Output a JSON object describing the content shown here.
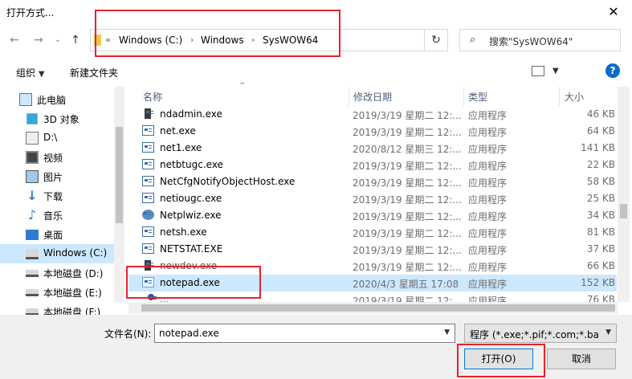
{
  "window": {
    "title": "打开方式...",
    "close_glyph": "✕"
  },
  "nav": {
    "back": "←",
    "forward": "→",
    "recent": "⌄",
    "up": "↑"
  },
  "address": {
    "prefix": "«",
    "crumbs": [
      "Windows (C:)",
      "Windows",
      "SysWOW64"
    ],
    "sep": "›",
    "refresh": "↻"
  },
  "search": {
    "placeholder": "搜索\"SysWOW64\"",
    "icon": "⌕"
  },
  "toolbar": {
    "organize": "组织",
    "new_folder": "新建文件夹",
    "help": "?"
  },
  "sidebar": {
    "items": [
      {
        "label": "此电脑",
        "icon": "pc-icon"
      },
      {
        "label": "3D 对象",
        "icon": "cube-icon"
      },
      {
        "label": "D:\\",
        "icon": "drive-icon"
      },
      {
        "label": "视频",
        "icon": "video-icon"
      },
      {
        "label": "图片",
        "icon": "picture-icon"
      },
      {
        "label": "下载",
        "icon": "download-icon"
      },
      {
        "label": "音乐",
        "icon": "music-icon"
      },
      {
        "label": "桌面",
        "icon": "desktop-icon"
      },
      {
        "label": "Windows (C:)",
        "icon": "drive-icon"
      },
      {
        "label": "本地磁盘 (D:)",
        "icon": "disk-icon"
      },
      {
        "label": "本地磁盘 (E:)",
        "icon": "disk-icon"
      },
      {
        "label": "本地磁盘 (F:)",
        "icon": "disk-icon"
      }
    ]
  },
  "columns": {
    "name": "名称",
    "date": "修改日期",
    "type": "类型",
    "size": "大小"
  },
  "files": [
    {
      "name": "ndadmin.exe",
      "date": "2019/3/19 星期二 12:...",
      "type": "应用程序",
      "size": "46 KB"
    },
    {
      "name": "net.exe",
      "date": "2019/3/19 星期二 12:...",
      "type": "应用程序",
      "size": "64 KB"
    },
    {
      "name": "net1.exe",
      "date": "2020/8/12 星期三 12:...",
      "type": "应用程序",
      "size": "141 KB"
    },
    {
      "name": "netbtugc.exe",
      "date": "2019/3/19 星期二 12:...",
      "type": "应用程序",
      "size": "22 KB"
    },
    {
      "name": "NetCfgNotifyObjectHost.exe",
      "date": "2019/3/19 星期二 12:...",
      "type": "应用程序",
      "size": "58 KB"
    },
    {
      "name": "netiougc.exe",
      "date": "2019/3/19 星期二 12:...",
      "type": "应用程序",
      "size": "25 KB"
    },
    {
      "name": "Netplwiz.exe",
      "date": "2019/3/19 星期二 12:...",
      "type": "应用程序",
      "size": "34 KB"
    },
    {
      "name": "netsh.exe",
      "date": "2019/3/19 星期二 12:...",
      "type": "应用程序",
      "size": "81 KB"
    },
    {
      "name": "NETSTAT.EXE",
      "date": "2019/3/19 星期二 12:...",
      "type": "应用程序",
      "size": "37 KB"
    },
    {
      "name": "newdev.exe",
      "date": "2019/3/19 星期二 12:...",
      "type": "应用程序",
      "size": "66 KB"
    },
    {
      "name": "notepad.exe",
      "date": "2020/4/3 星期五 17:08",
      "type": "应用程序",
      "size": "152 KB",
      "selected": true
    },
    {
      "name": "...",
      "date": "2019/3/19 星期二 12:...",
      "type": "应用程序",
      "size": "76 KB"
    }
  ],
  "footer": {
    "filename_label": "文件名(N):",
    "filename_value": "notepad.exe",
    "filetype_value": "程序 (*.exe;*.pif;*.com;*.bat;*.",
    "open_label": "打开(O)",
    "cancel_label": "取消"
  },
  "colors": {
    "selection": "#cce8ff",
    "highlight": "#e8212d",
    "accent": "#0078d7"
  }
}
